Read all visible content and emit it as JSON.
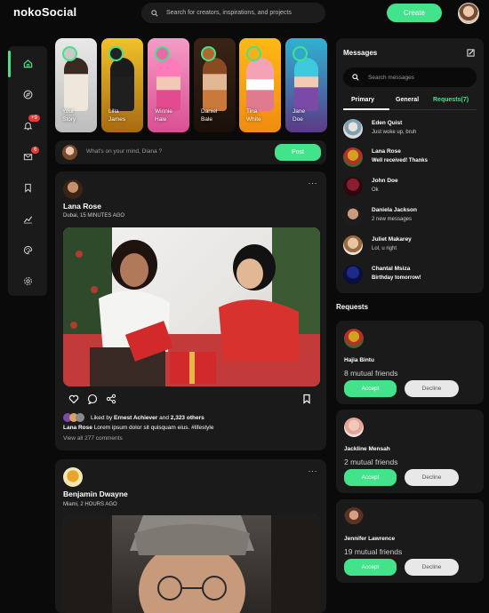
{
  "app": {
    "name": "nokoSocial",
    "search_placeholder": "Search for creators, inspirations, and projects",
    "create_label": "Create"
  },
  "sidebar": {
    "items": [
      {
        "icon": "home-icon",
        "active": true
      },
      {
        "icon": "explore-icon"
      },
      {
        "icon": "bell-icon",
        "badge": "+9"
      },
      {
        "icon": "mail-icon",
        "badge": "6"
      },
      {
        "icon": "bookmark-icon"
      },
      {
        "icon": "analytics-icon"
      },
      {
        "icon": "palette-icon"
      },
      {
        "icon": "gear-icon"
      }
    ]
  },
  "stories": [
    {
      "name_line1": "Your",
      "name_line2": "Story",
      "color": "#c9c9c9"
    },
    {
      "name_line1": "Lilla",
      "name_line2": "James",
      "color": "#d4a11a"
    },
    {
      "name_line1": "Winnie",
      "name_line2": "Hale",
      "color": "#e86aa8"
    },
    {
      "name_line1": "Daniel",
      "name_line2": "Bale",
      "color": "#b5652e"
    },
    {
      "name_line1": "Tina",
      "name_line2": "White",
      "color": "#f2b21b"
    },
    {
      "name_line1": "Jane",
      "name_line2": "Doe",
      "color": "#2fa8c9"
    }
  ],
  "composer": {
    "placeholder": "What's on your mind, Diana ?",
    "post_label": "Post"
  },
  "posts": [
    {
      "author": "Lana Rose",
      "meta": "Dubai, 15 MINUTES AGO",
      "liked_prefix": "Liked by",
      "liked_name": "Ernest Achiever",
      "liked_mid": "and",
      "liked_count": "2,323 others",
      "caption_author": "Lana Rose",
      "caption_text": "Lorem ipsum dolor sit quisquam eius.",
      "caption_tag": "#lifestyle",
      "comments": "View all 277 comments"
    },
    {
      "author": "Benjamin Dwayne",
      "meta": "Miami, 2 HOURS AGO"
    }
  ],
  "messages": {
    "title": "Messages",
    "search_placeholder": "Search messages",
    "tabs": [
      "Primary",
      "General",
      "Requests(7)"
    ],
    "items": [
      {
        "name": "Eden Quist",
        "text": "Just woke up, bruh",
        "bold": false
      },
      {
        "name": "Lana Rose",
        "text": "Well received! Thanks",
        "bold": true
      },
      {
        "name": "John Doe",
        "text": "Ok",
        "bold": false
      },
      {
        "name": "Daniela Jackson",
        "text": "2 new messages",
        "bold": false
      },
      {
        "name": "Juliet Makarey",
        "text": "Lol, u right",
        "bold": false
      },
      {
        "name": "Chantal Msiza",
        "text": "Birthday tomorrow!",
        "bold": true
      }
    ]
  },
  "requests": {
    "title": "Requests",
    "accept_label": "Accept",
    "decline_label": "Decline",
    "items": [
      {
        "name": "Hajia Bintu",
        "mutual": "8 mutual friends"
      },
      {
        "name": "Jackline Mensah",
        "mutual": "2 mutual friends"
      },
      {
        "name": "Jennifer Lawrence",
        "mutual": "19 mutual friends"
      }
    ]
  },
  "colors": {
    "accent": "#42e38b",
    "panel": "#1a1a1a",
    "background": "#0a0a0a",
    "badge": "#e53935"
  }
}
